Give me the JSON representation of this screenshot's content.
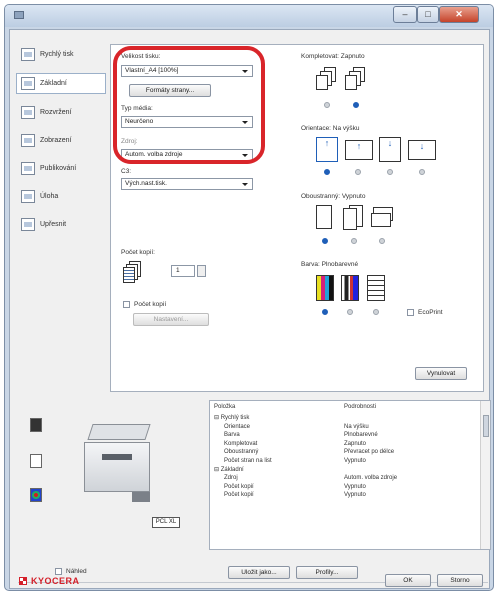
{
  "nav": {
    "items": [
      {
        "label": "Rychlý tisk",
        "icon": "quick-print-icon"
      },
      {
        "label": "Základní",
        "icon": "basic-icon"
      },
      {
        "label": "Rozvržení",
        "icon": "layout-icon"
      },
      {
        "label": "Zobrazení",
        "icon": "imaging-icon"
      },
      {
        "label": "Publikování",
        "icon": "publishing-icon"
      },
      {
        "label": "Úloha",
        "icon": "job-icon"
      },
      {
        "label": "Upřesnit",
        "icon": "advanced-icon"
      }
    ],
    "active_index": 1
  },
  "basic": {
    "page_size_label": "Velikost tisku:",
    "page_size_value": "Vlastní_A4 [100%]",
    "page_formats_button": "Formáty strany...",
    "media_type_label": "Typ média:",
    "media_type_value": "Neurčeno",
    "source_label": "Zdroj:",
    "source_value": "Autom. volba zdroje",
    "destination_label": "C3:",
    "destination_value": "Vých.nast.tisk.",
    "copies_label": "Počet kopií:",
    "copies_value": "1",
    "copy_count_label": "Počet kopií",
    "settings_button": "Nastavení..."
  },
  "options": {
    "collate_label": "Kompletovat: Zapnuto",
    "orientation_label": "Orientace: Na výšku",
    "duplex_label": "Oboustranný: Vypnuto",
    "color_label": "Barva: Plnobarevné",
    "ecoprint_label": "EcoPrint",
    "reset_button": "Vynulovat"
  },
  "summary": {
    "col_feature": "Položka",
    "col_details": "Podrobnosti",
    "rows": [
      {
        "item": "⊟ Rychlý tisk",
        "value": "",
        "indent": 0
      },
      {
        "item": "Orientace",
        "value": "Na výšku",
        "indent": 1
      },
      {
        "item": "Barva",
        "value": "Plnobarevné",
        "indent": 1
      },
      {
        "item": "Kompletovat",
        "value": "Zapnuto",
        "indent": 1
      },
      {
        "item": "Oboustranný",
        "value": "Převracet po délce",
        "indent": 1
      },
      {
        "item": "Počet stran na list",
        "value": "Vypnuto",
        "indent": 1
      },
      {
        "item": "⊟ Základní",
        "value": "",
        "indent": 0
      },
      {
        "item": "Zdroj",
        "value": "Autom. volba zdroje",
        "indent": 1
      },
      {
        "item": "Počet kopií",
        "value": "Vypnuto",
        "indent": 1
      },
      {
        "item": "Počet kopií",
        "value": "Vypnuto",
        "indent": 1
      }
    ]
  },
  "printer": {
    "badge": "PCL XL"
  },
  "footer": {
    "preview_label": "Náhled",
    "save_as_button": "Uložit jako...",
    "profiles_button": "Profily...",
    "ok_button": "OK",
    "cancel_button": "Storno",
    "brand": "KYOCERA"
  },
  "colors": {
    "highlight": "#d9252a",
    "radio_selected": "#1f5fb8",
    "brand_red": "#d4202a"
  }
}
